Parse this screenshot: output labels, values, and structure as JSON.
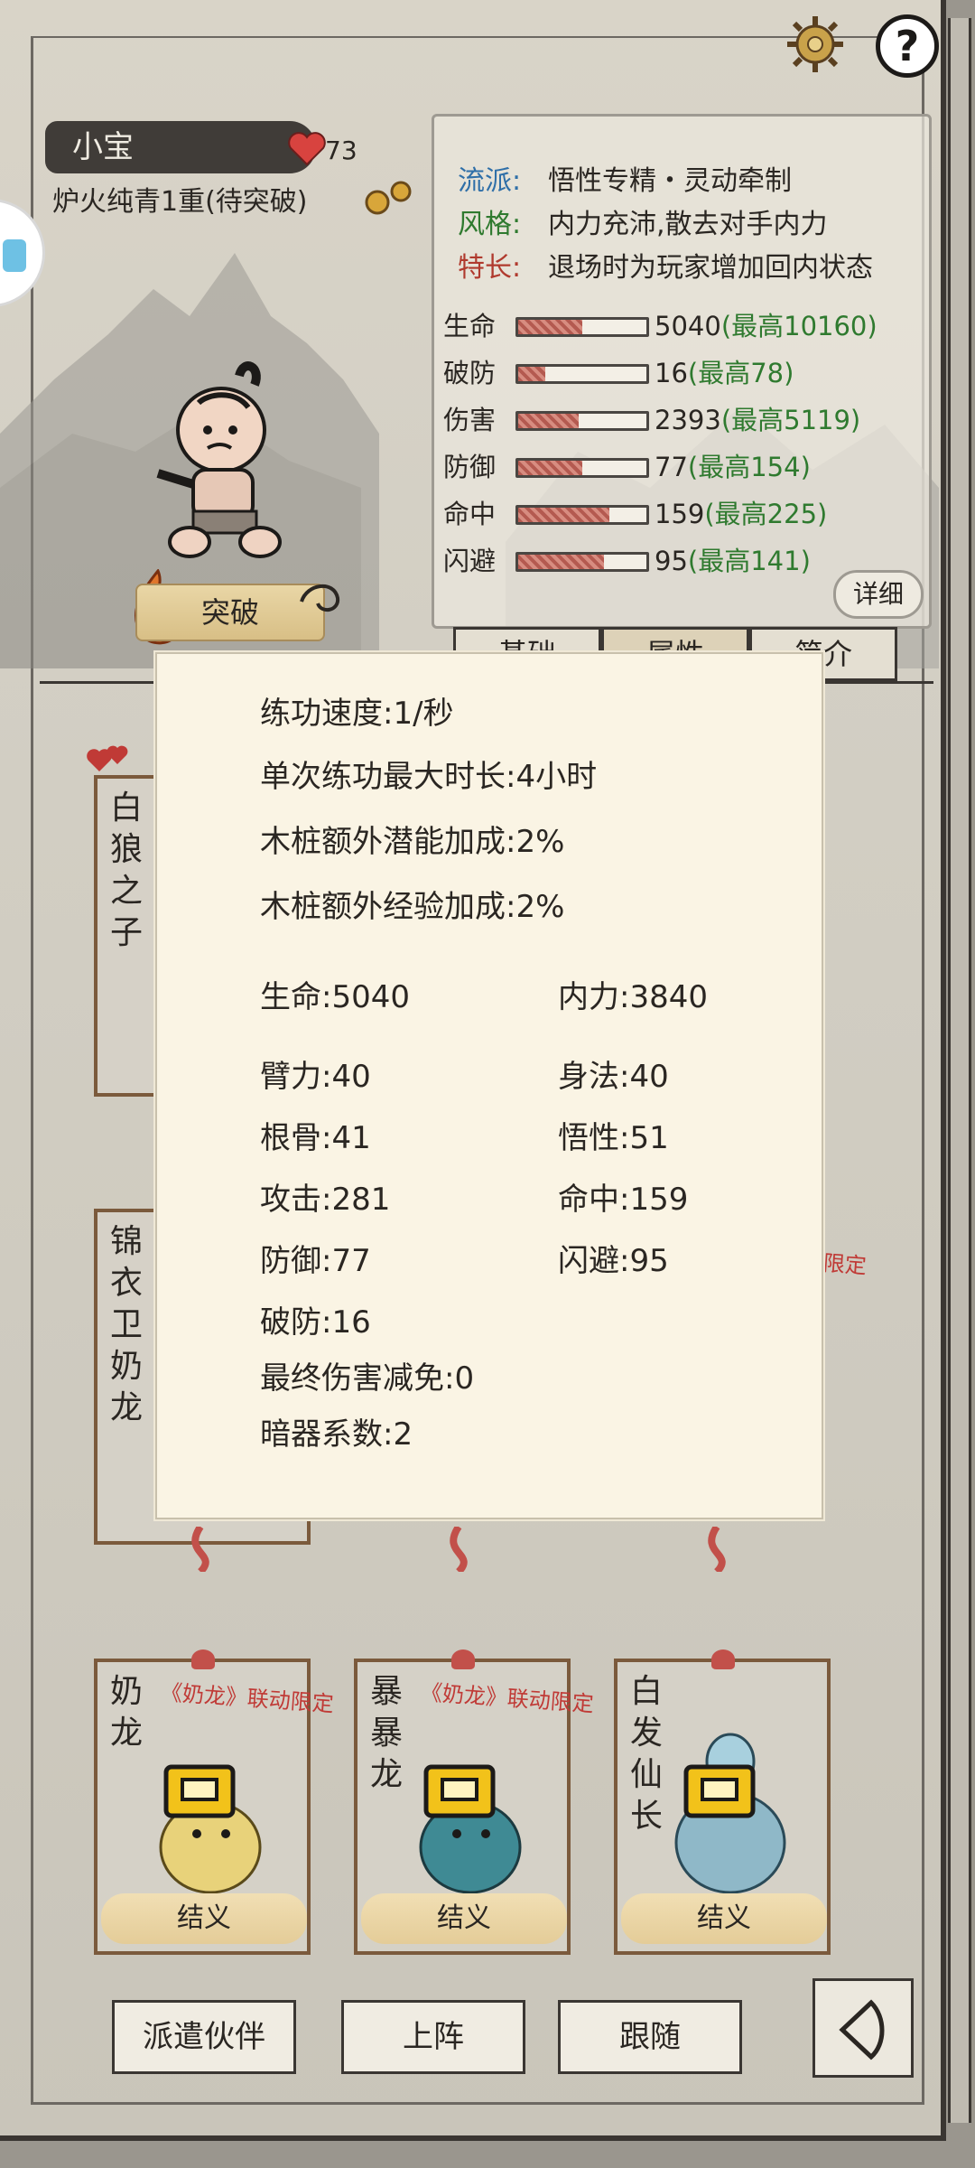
{
  "hero": {
    "name": "小宝",
    "hp": "73",
    "realm": "炉火纯青1重(待突破)",
    "breakthrough_label": "突破"
  },
  "traits": [
    {
      "key": "流派:",
      "value": "悟性专精・灵动牵制",
      "color": "#2f6fa8"
    },
    {
      "key": "风格:",
      "value": "内力充沛,散去对手内力",
      "color": "#2f7a2f"
    },
    {
      "key": "特长:",
      "value": "退场时为玩家增加回内状态",
      "color": "#b03a2e"
    }
  ],
  "stats": [
    {
      "label": "生命",
      "value": "5040",
      "max": "(最高10160)",
      "fill": 0.5
    },
    {
      "label": "破防",
      "value": "16",
      "max": "(最高78)",
      "fill": 0.21
    },
    {
      "label": "伤害",
      "value": "2393",
      "max": "(最高5119)",
      "fill": 0.47
    },
    {
      "label": "防御",
      "value": "77",
      "max": "(最高154)",
      "fill": 0.5
    },
    {
      "label": "命中",
      "value": "159",
      "max": "(最高225)",
      "fill": 0.71
    },
    {
      "label": "闪避",
      "value": "95",
      "max": "(最高141)",
      "fill": 0.67
    }
  ],
  "detail_label": "详细",
  "tabs": [
    "基础",
    "属性",
    "简介"
  ],
  "companions": [
    {
      "name": "白狼之子"
    },
    {
      "name": "锦衣卫奶龙"
    },
    {
      "name": "奶龙",
      "tag": "《奶龙》联动限定",
      "button": "结义"
    },
    {
      "name": "暴暴龙",
      "tag": "《奶龙》联动限定",
      "button": "结义"
    },
    {
      "name": "白发仙长",
      "button": "结义"
    }
  ],
  "partial_tag": "限定",
  "bottom_buttons": [
    "派遣伙伴",
    "上阵",
    "跟随"
  ],
  "popup": {
    "lines": [
      "练功速度:1/秒",
      "单次练功最大时长:4小时",
      "木桩额外潜能加成:2%",
      "木桩额外经验加成:2%"
    ],
    "attrs_left": [
      "生命:5040",
      "臂力:40",
      "根骨:41",
      "攻击:281",
      "防御:77",
      "破防:16",
      "最终伤害减免:0",
      "暗器系数:2"
    ],
    "attrs_right": [
      "内力:3840",
      "身法:40",
      "悟性:51",
      "命中:159",
      "闪避:95"
    ]
  }
}
